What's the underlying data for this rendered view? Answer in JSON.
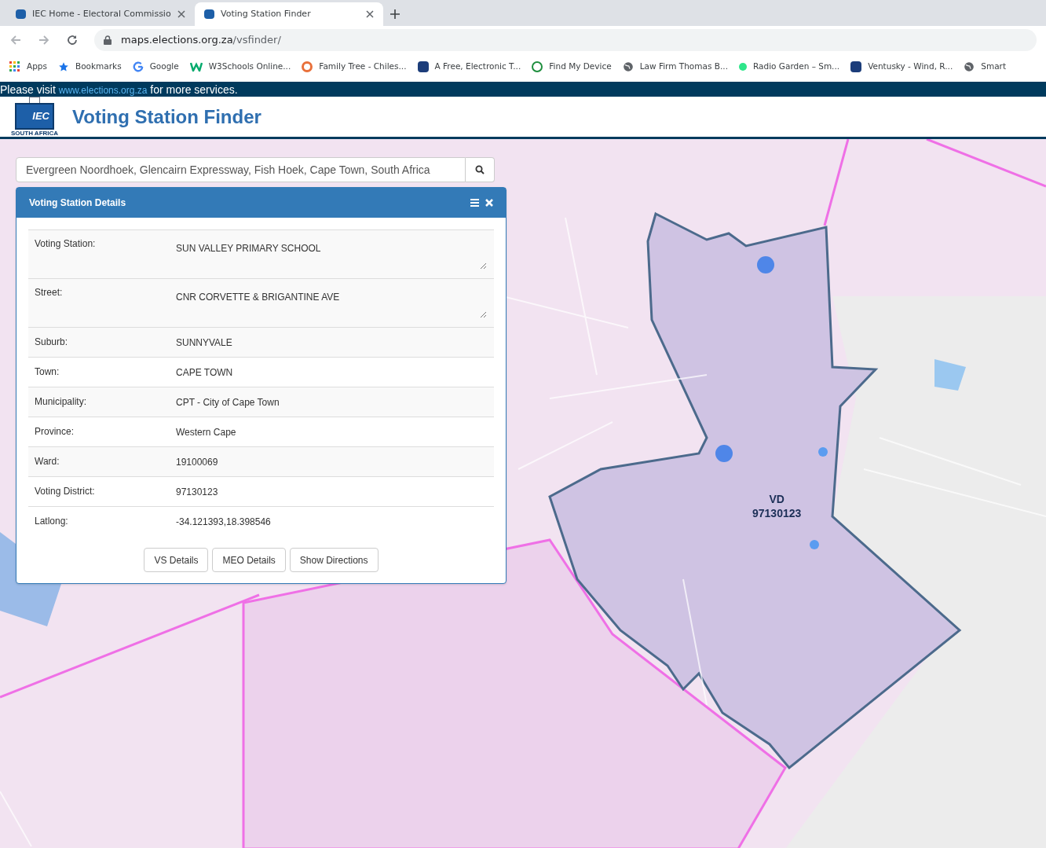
{
  "browser": {
    "tabs": [
      {
        "title": "IEC Home - Electoral Commissio",
        "selected": false
      },
      {
        "title": "Voting Station Finder",
        "selected": true
      }
    ],
    "url": {
      "host": "maps.elections.org.za",
      "path": "/vsfinder/"
    },
    "bookmarks": [
      {
        "label": "Apps",
        "kind": "apps"
      },
      {
        "label": "Bookmarks",
        "kind": "star"
      },
      {
        "label": "Google",
        "kind": "google"
      },
      {
        "label": "W3Schools Online...",
        "kind": "w3"
      },
      {
        "label": "Family Tree - Chiles...",
        "kind": "ring"
      },
      {
        "label": "A Free, Electronic T...",
        "kind": "square"
      },
      {
        "label": "Find My Device",
        "kind": "device"
      },
      {
        "label": "Law Firm Thomas B...",
        "kind": "globe"
      },
      {
        "label": "Radio Garden – Sm...",
        "kind": "dot"
      },
      {
        "label": "Ventusky - Wind, R...",
        "kind": "square"
      },
      {
        "label": "Smart",
        "kind": "globe"
      }
    ]
  },
  "banner": {
    "before": "Please visit",
    "link": "www.elections.org.za",
    "after": "for more services."
  },
  "header": {
    "logo_text": "IEC",
    "logo_caption": "SOUTH AFRICA",
    "title": "Voting Station Finder"
  },
  "search": {
    "value": "Evergreen Noordhoek, Glencairn Expressway, Fish Hoek, Cape Town, South Africa"
  },
  "panel": {
    "title": "Voting Station Details",
    "rows": [
      {
        "label": "Voting Station:",
        "value": "SUN VALLEY PRIMARY SCHOOL",
        "kind": "textarea"
      },
      {
        "label": "Street:",
        "value": "CNR CORVETTE & BRIGANTINE AVE",
        "kind": "textarea"
      },
      {
        "label": "Suburb:",
        "value": "SUNNYVALE",
        "kind": "text"
      },
      {
        "label": "Town:",
        "value": "CAPE TOWN",
        "kind": "text"
      },
      {
        "label": "Municipality:",
        "value": "CPT - City of Cape Town",
        "kind": "text"
      },
      {
        "label": "Province:",
        "value": "Western Cape",
        "kind": "text"
      },
      {
        "label": "Ward:",
        "value": "19100069",
        "kind": "text"
      },
      {
        "label": "Voting District:",
        "value": "97130123",
        "kind": "text"
      },
      {
        "label": "Latlong:",
        "value": "-34.121393,18.398546",
        "kind": "text"
      }
    ],
    "buttons": [
      "VS Details",
      "MEO Details",
      "Show Directions"
    ]
  },
  "map": {
    "district_label": [
      "VD",
      "97130123"
    ]
  }
}
